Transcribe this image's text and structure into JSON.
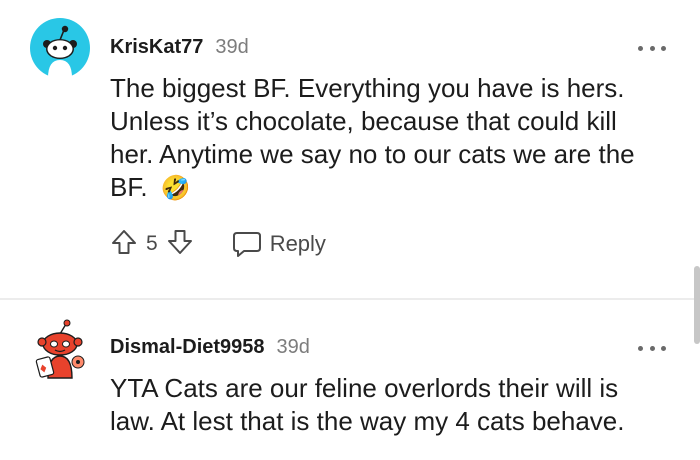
{
  "comments": [
    {
      "username": "KrisKat77",
      "age": "39d",
      "text_lines": [
        "The biggest BF. Everything you have is hers.",
        "Unless it’s chocolate, because that could kill",
        "her. Anytime we say no to our cats we are the",
        "BF."
      ],
      "emoji": "🤣",
      "votes": "5",
      "reply_label": "Reply",
      "avatar_icon": "snoo-avatar-icon"
    },
    {
      "username": "Dismal-Diet9958",
      "age": "39d",
      "text_lines": [
        "YTA Cats are our feline overlords their will is",
        "law. At lest that is the way my 4 cats behave."
      ],
      "avatar_icon": "snoo-avatar-icon"
    }
  ],
  "colors": {
    "avatar_bg": "#29c7e6",
    "avatar2_accent": "#e8422c",
    "text": "#1c1c1c",
    "muted": "#7c7c7c",
    "divider": "#ececec"
  }
}
